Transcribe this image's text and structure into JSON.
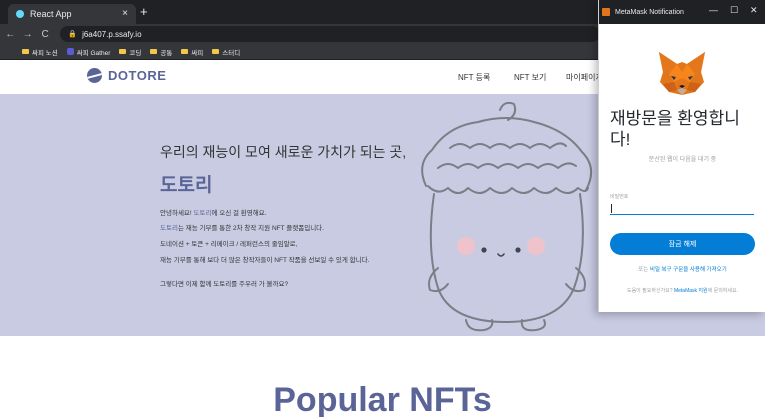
{
  "browser": {
    "tab_title": "React App",
    "tab_close": "×",
    "new_tab": "+",
    "nav_back": "←",
    "nav_forward": "→",
    "nav_reload": "C",
    "url": "j6a407.p.ssafy.io",
    "bookmarks": [
      {
        "label": "싸피 노션",
        "icon": "folder-icon"
      },
      {
        "label": "싸피 Gather",
        "icon": "gather-icon"
      },
      {
        "label": "코딩",
        "icon": "folder-icon"
      },
      {
        "label": "공통",
        "icon": "folder-icon"
      },
      {
        "label": "싸피",
        "icon": "folder-icon"
      },
      {
        "label": "스터디",
        "icon": "folder-icon"
      }
    ]
  },
  "site": {
    "logo_text": "DOTORE",
    "nav": [
      "NFT 등록",
      "NFT 보기",
      "마이페이지"
    ],
    "accent_color": "#5b6497",
    "hero_bg": "#c9cbe3"
  },
  "hero": {
    "title": "우리의 재능이 모여 새로운 가치가 되는 곳,",
    "brand": "도토리",
    "line1_pre": "안녕하세요! ",
    "line1_hl": "도토리",
    "line1_post": "에 오신 걸 환영해요.",
    "line2_hl": "도토리",
    "line2_post": "는 재능 기부를 통한 2차 창작 지원 NFT 플랫폼입니다.",
    "line3": "도네이션 + 토큰 + 리메이크 / 레퍼런스의 줄임말로,",
    "line4": "재능 기부를 통해 보다 더 많은 창작자들이 NFT 작품을 선보일 수 있게 합니다.",
    "line5": "그렇다면 이제 함께 도토리를 주우러 가 볼까요?"
  },
  "popular_title": "Popular NFTs",
  "metamask": {
    "window_title": "MetaMask Notification",
    "minimize": "—",
    "maximize": "☐",
    "close": "✕",
    "welcome_title": "재방문을 환영합니다!",
    "subtitle": "분산된 웹이 다음을 대기 중",
    "password_label": "비밀번호",
    "password_value": "",
    "unlock_button": "잠금 해제",
    "or_prefix": "또는 ",
    "restore_link": "비밀 복구 구문을 사용해 가져오기",
    "help_prefix": "도움이 필요하신가요? ",
    "help_link": "MetaMask 지원",
    "help_suffix": "에 문의하세요.",
    "accent_color": "#037dd6"
  }
}
